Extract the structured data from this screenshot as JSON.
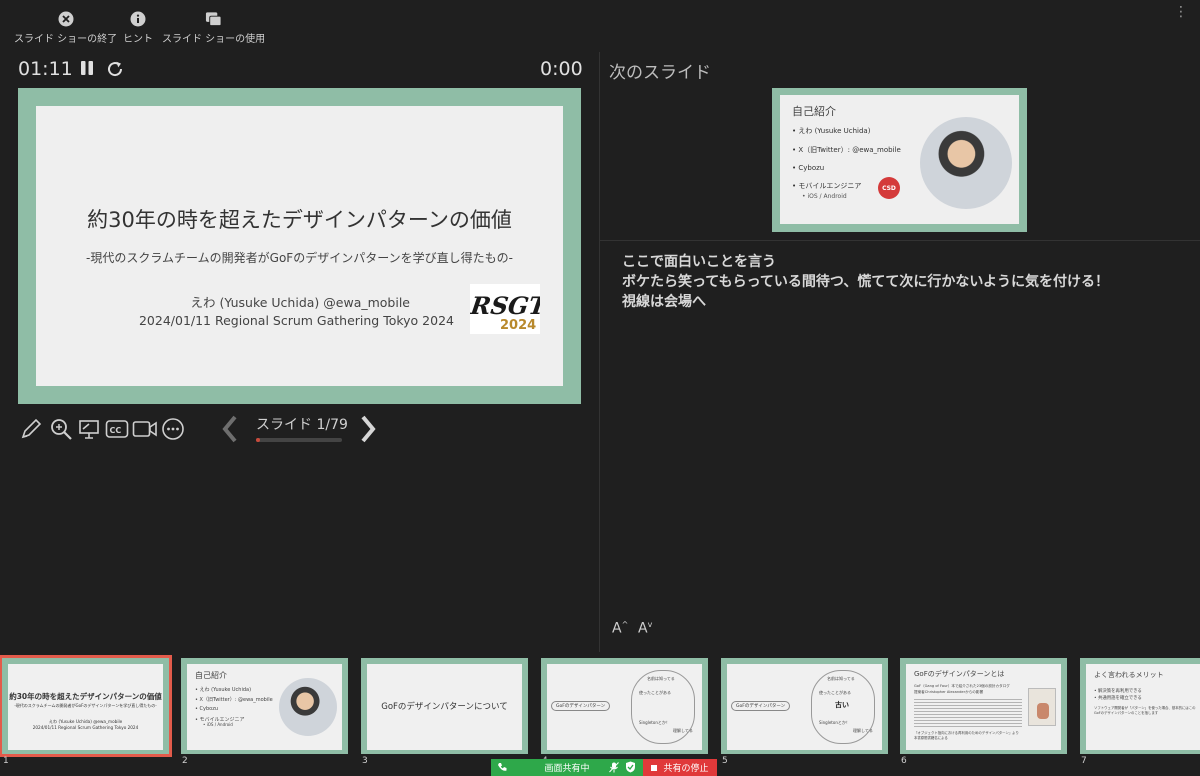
{
  "toolbar": {
    "end_show": "スライド ショーの終了",
    "hint": "ヒント",
    "use_show": "スライド ショーの使用"
  },
  "timer": {
    "elapsed": "01:11",
    "clock": "0:00"
  },
  "current_slide": {
    "title": "約30年の時を超えたデザインパターンの価値",
    "subtitle": "-現代のスクラムチームの開発者がGoFのデザインパターンを学び直し得たもの-",
    "author": "えわ (Yusuke Uchida) @ewa_mobile",
    "date_event": "2024/01/11 Regional Scrum Gathering Tokyo 2024",
    "logo_text": "RSGT",
    "logo_year": "2024"
  },
  "navigation": {
    "slide_counter": "スライド 1/79",
    "progress": 0.0127
  },
  "next_slide": {
    "label": "次のスライド",
    "title": "自己紹介",
    "items": [
      "• えわ (Yusuke Uchida)",
      "• X（旧Twitter）: @ewa_mobile",
      "• Cybozu",
      "• モバイルエンジニア"
    ],
    "sub_item": "• iOS / Android",
    "badge": "CSD"
  },
  "notes": {
    "lines": [
      "ここで面白いことを言う",
      "ボケたら笑ってもらっている間待つ、慌てて次に行かないように気を付ける！",
      "視線は会場へ"
    ]
  },
  "font_controls": {
    "increase": "A",
    "decrease": "A"
  },
  "thumbnails": [
    {
      "num": "1",
      "title": "約30年の時を超えたデザインパターンの価値",
      "sub": "-現代のスクラムチームの開発者がGoFのデザインパターンを学び直し得たもの-",
      "author": "えわ (Yusuke Uchida) @ewa_mobile",
      "date": "2024/01/11 Regional Scrum Gathering Tokyo 2024"
    },
    {
      "num": "2",
      "title": "自己紹介",
      "items": [
        "• えわ (Yusuke Uchida)",
        "• X（旧Twitter）: @ewa_mobile",
        "• Cybozu",
        "• モバイルエンジニア"
      ],
      "sub": "• iOS / Android"
    },
    {
      "num": "3",
      "title": "GoFのデザインパターンについて"
    },
    {
      "num": "4",
      "label": "GoFのデザインパターン",
      "bubble": [
        "名前は知ってる",
        "使ったことがある",
        "Singletonとか！",
        "理解してる"
      ]
    },
    {
      "num": "5",
      "label": "GoFのデザインパターン",
      "center": "古い",
      "bubble": [
        "名前は知ってる",
        "使ったことがある",
        "Singletonとか！",
        "理解してる"
      ]
    },
    {
      "num": "6",
      "title": "GoFのデザインパターンとは",
      "line1": "GoF（Gang of Four）本で紹介された23個の設計カタログ",
      "line2": "提案者Christopher Alexanderからの影響",
      "line3": "『オブジェクト指向における再利用のためのデザインパターン』より",
      "line4": "本書原題書籍名による"
    },
    {
      "num": "7",
      "title": "よく言われるメリット",
      "items": [
        "• 解決策を再利用できる",
        "• 共通用語を確立できる"
      ],
      "note": "ソフトウェア開発者が「パターン」を使った場合、基本的にはこのGoFのデザインパターンのことを指します"
    }
  ],
  "share_bar": {
    "sharing": "画面共有中",
    "stop": "共有の停止"
  },
  "colors": {
    "accent": "#8fbda6",
    "active_outline": "#e35b4b",
    "share_green": "#2ea84a",
    "share_red": "#e0393a"
  }
}
